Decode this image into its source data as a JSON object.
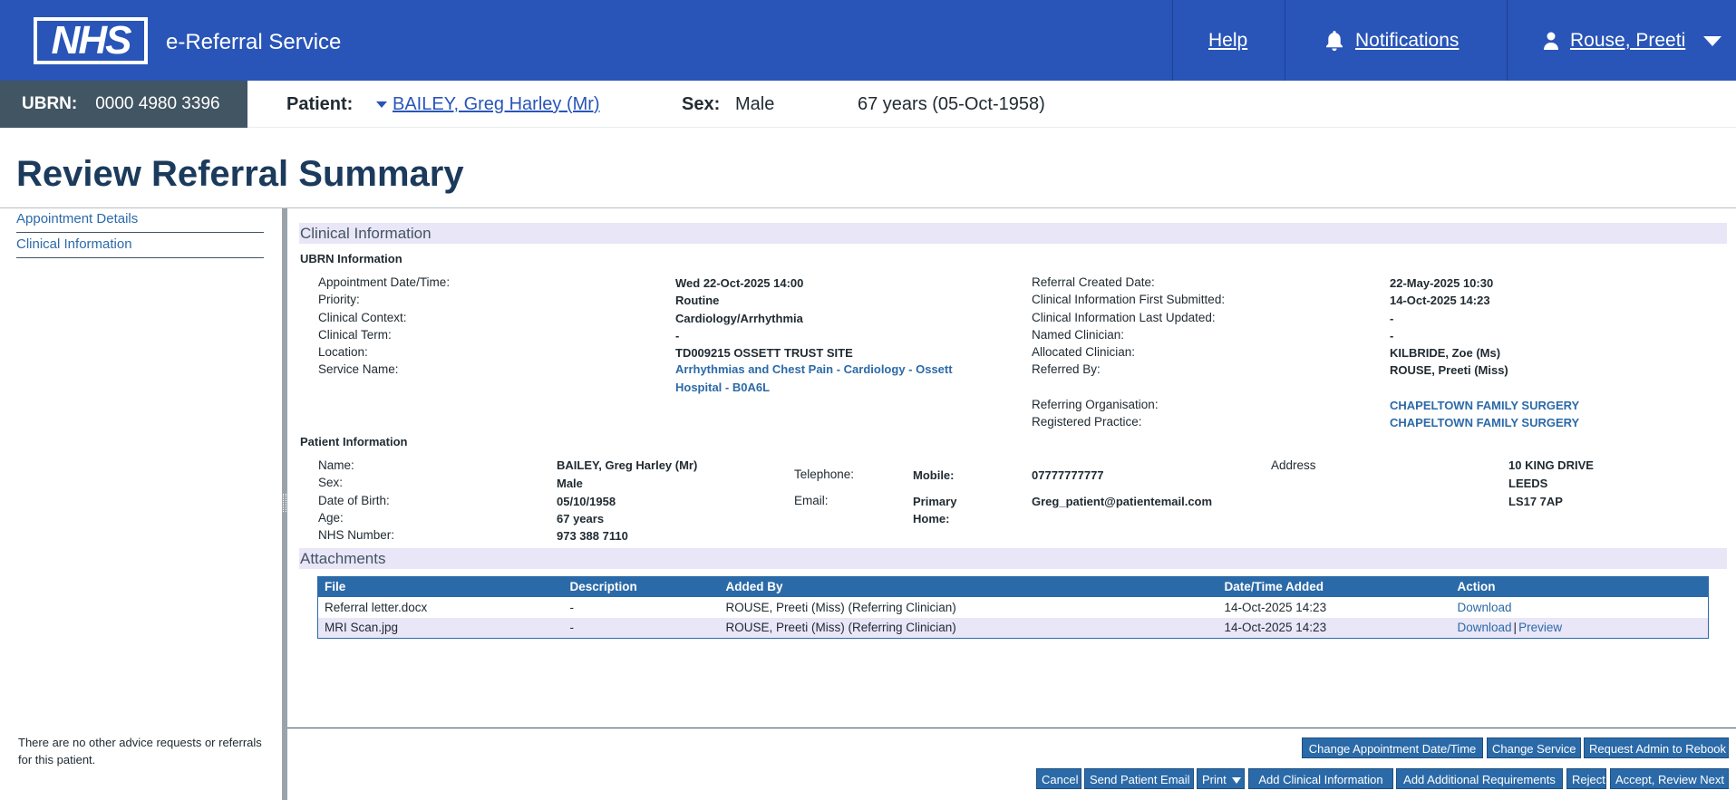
{
  "header": {
    "logo_text": "NHS",
    "service_name": "e-Referral Service",
    "help_label": "Help",
    "notifications_label": "Notifications",
    "user_label": "Rouse, Preeti"
  },
  "banner": {
    "ubrn_label": "UBRN:",
    "ubrn_value": "0000 4980 3396",
    "patient_label": "Patient:",
    "patient_name": "BAILEY, Greg Harley (Mr)",
    "sex_label": "Sex:",
    "sex_value": "Male",
    "age_dob": "67 years (05-Oct-1958)"
  },
  "page_title": "Review Referral Summary",
  "nav": {
    "items": [
      "Appointment Details",
      "Clinical Information"
    ],
    "note": "There are no other advice requests or referrals for this patient."
  },
  "clinical": {
    "section_title": "Clinical Information",
    "ubrn_info_title": "UBRN Information",
    "left_labels": [
      "Appointment Date/Time:",
      "Priority:",
      "Clinical Context:",
      "Clinical Term:",
      "Location:",
      "Service Name:"
    ],
    "left_values": [
      "Wed 22-Oct-2025 14:00",
      "Routine",
      "Cardiology/Arrhythmia",
      "-",
      "TD009215 OSSETT TRUST SITE"
    ],
    "service_name_value": "Arrhythmias and Chest Pain - Cardiology - Ossett Hospital - B0A6L",
    "right_labels": [
      "Referral Created Date:",
      "Clinical Information First Submitted:",
      "Clinical Information Last Updated:",
      "Named Clinician:",
      "Allocated Clinician:",
      "Referred By:"
    ],
    "right_values": [
      "22-May-2025 10:30",
      "14-Oct-2025 14:23",
      "-",
      "-",
      "KILBRIDE, Zoe (Ms)",
      "ROUSE, Preeti (Miss)"
    ],
    "referring_org_label": "Referring Organisation:",
    "referring_org_value": "CHAPELTOWN FAMILY SURGERY",
    "registered_practice_label": "Registered Practice:",
    "registered_practice_value": "CHAPELTOWN FAMILY SURGERY"
  },
  "patient_info": {
    "title": "Patient Information",
    "labels": [
      "Name:",
      "Sex:",
      "Date of Birth:",
      "Age:",
      "NHS Number:"
    ],
    "values": [
      "BAILEY, Greg Harley (Mr)",
      "Male",
      "05/10/1958",
      "67 years",
      "973 388 7110"
    ],
    "telephone_label": "Telephone:",
    "mobile_label": "Mobile:",
    "mobile_value": "07777777777",
    "email_label": "Email:",
    "primary_label": "Primary",
    "home_label": "Home:",
    "email_value": "Greg_patient@patientemail.com",
    "address_label": "Address",
    "address_lines": [
      "10 KING DRIVE",
      "LEEDS",
      "LS17 7AP"
    ]
  },
  "attachments": {
    "title": "Attachments",
    "columns": [
      "File",
      "Description",
      "Added By",
      "Date/Time Added",
      "Action"
    ],
    "rows": [
      {
        "file": "Referral letter.docx",
        "description": "-",
        "added_by": "ROUSE, Preeti (Miss) (Referring Clinician)",
        "date": "14-Oct-2025 14:23",
        "download": "Download",
        "preview": ""
      },
      {
        "file": "MRI Scan.jpg",
        "description": "-",
        "added_by": "ROUSE, Preeti (Miss) (Referring Clinician)",
        "date": "14-Oct-2025 14:23",
        "download": "Download",
        "preview": "Preview"
      }
    ],
    "separator": "|"
  },
  "actions": {
    "row1": [
      "Change Appointment Date/Time",
      "Change Service",
      "Request Admin to Rebook"
    ],
    "row2": [
      "Cancel",
      "Send Patient Email",
      "Print",
      "Add Clinical Information",
      "Add Additional Requirements",
      "Reject",
      "Accept, Review Next"
    ]
  },
  "colors": {
    "header_blue": "#2955b8",
    "ubrn_grey": "#425563",
    "link_blue": "#2b6aa8",
    "section_lilac": "#e9e6f7"
  }
}
